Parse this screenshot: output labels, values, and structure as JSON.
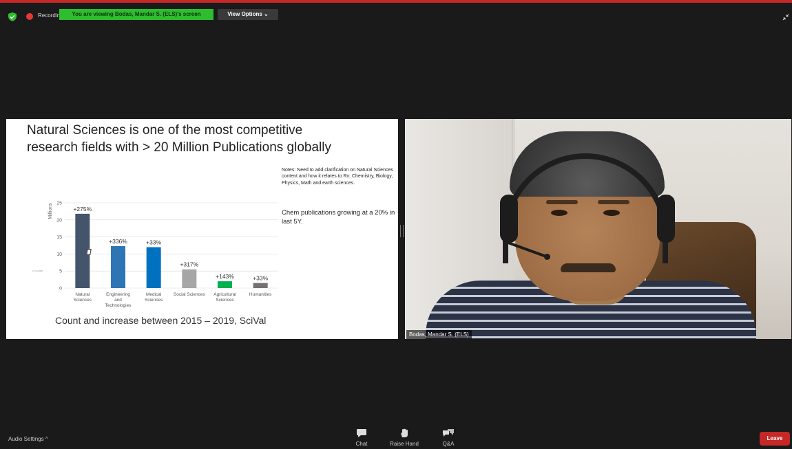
{
  "top_bar": {
    "recording_label": "Recording",
    "viewing_banner": "You are viewing Bodas, Mandar S. (ELS)'s screen",
    "view_options_label": "View Options",
    "view_options_caret": "⌄"
  },
  "slide": {
    "title_line1": "Natural Sciences is one of the most competitive",
    "title_line2": "research fields with > 20 Million Publications globally",
    "notes": "Notes: Need to add clarification on Natural Sciences content and how it relates to Rx: Chemistry, Biology, Physics, Math and earth sciences.",
    "chem_note": "Chem publications growing at a 20% in last 5Y.",
    "caption": "Count and increase between 2015 – 2019, SciVal",
    "tiny_label": "27.10.2006"
  },
  "chart_data": {
    "type": "bar",
    "ylabel": "Millions",
    "ylim": [
      0,
      25
    ],
    "yticks": [
      0,
      5,
      10,
      15,
      20,
      25
    ],
    "grid": true,
    "categories": [
      [
        "Natural",
        "Sciences"
      ],
      [
        "Engineering",
        "and",
        "Technologies"
      ],
      [
        "Medical",
        "Sciences"
      ],
      [
        "Social Sciences"
      ],
      [
        "Agricultural",
        "Sciences"
      ],
      [
        "Humanities"
      ]
    ],
    "values": [
      21.8,
      12.3,
      12.0,
      5.5,
      2.0,
      1.5
    ],
    "growth_labels": [
      "+275%",
      "+336%",
      "+33%",
      "+317%",
      "+143%",
      "+33%"
    ],
    "colors": [
      "#44546a",
      "#2e75b6",
      "#0070c0",
      "#a6a6a6",
      "#00b050",
      "#767171"
    ]
  },
  "video": {
    "participant_name": "Bodas, Mandar S. (ELS)"
  },
  "bottom_bar": {
    "audio_settings_label": "Audio Settings",
    "audio_caret": "^",
    "tools": [
      {
        "label": "Chat",
        "icon": "chat-icon"
      },
      {
        "label": "Raise Hand",
        "icon": "raise-hand-icon"
      },
      {
        "label": "Q&A",
        "icon": "qa-icon"
      }
    ],
    "leave_label": "Leave"
  },
  "colors": {
    "recording_red": "#e53935",
    "banner_green": "#2ebd2e",
    "leave_red": "#c62828"
  }
}
